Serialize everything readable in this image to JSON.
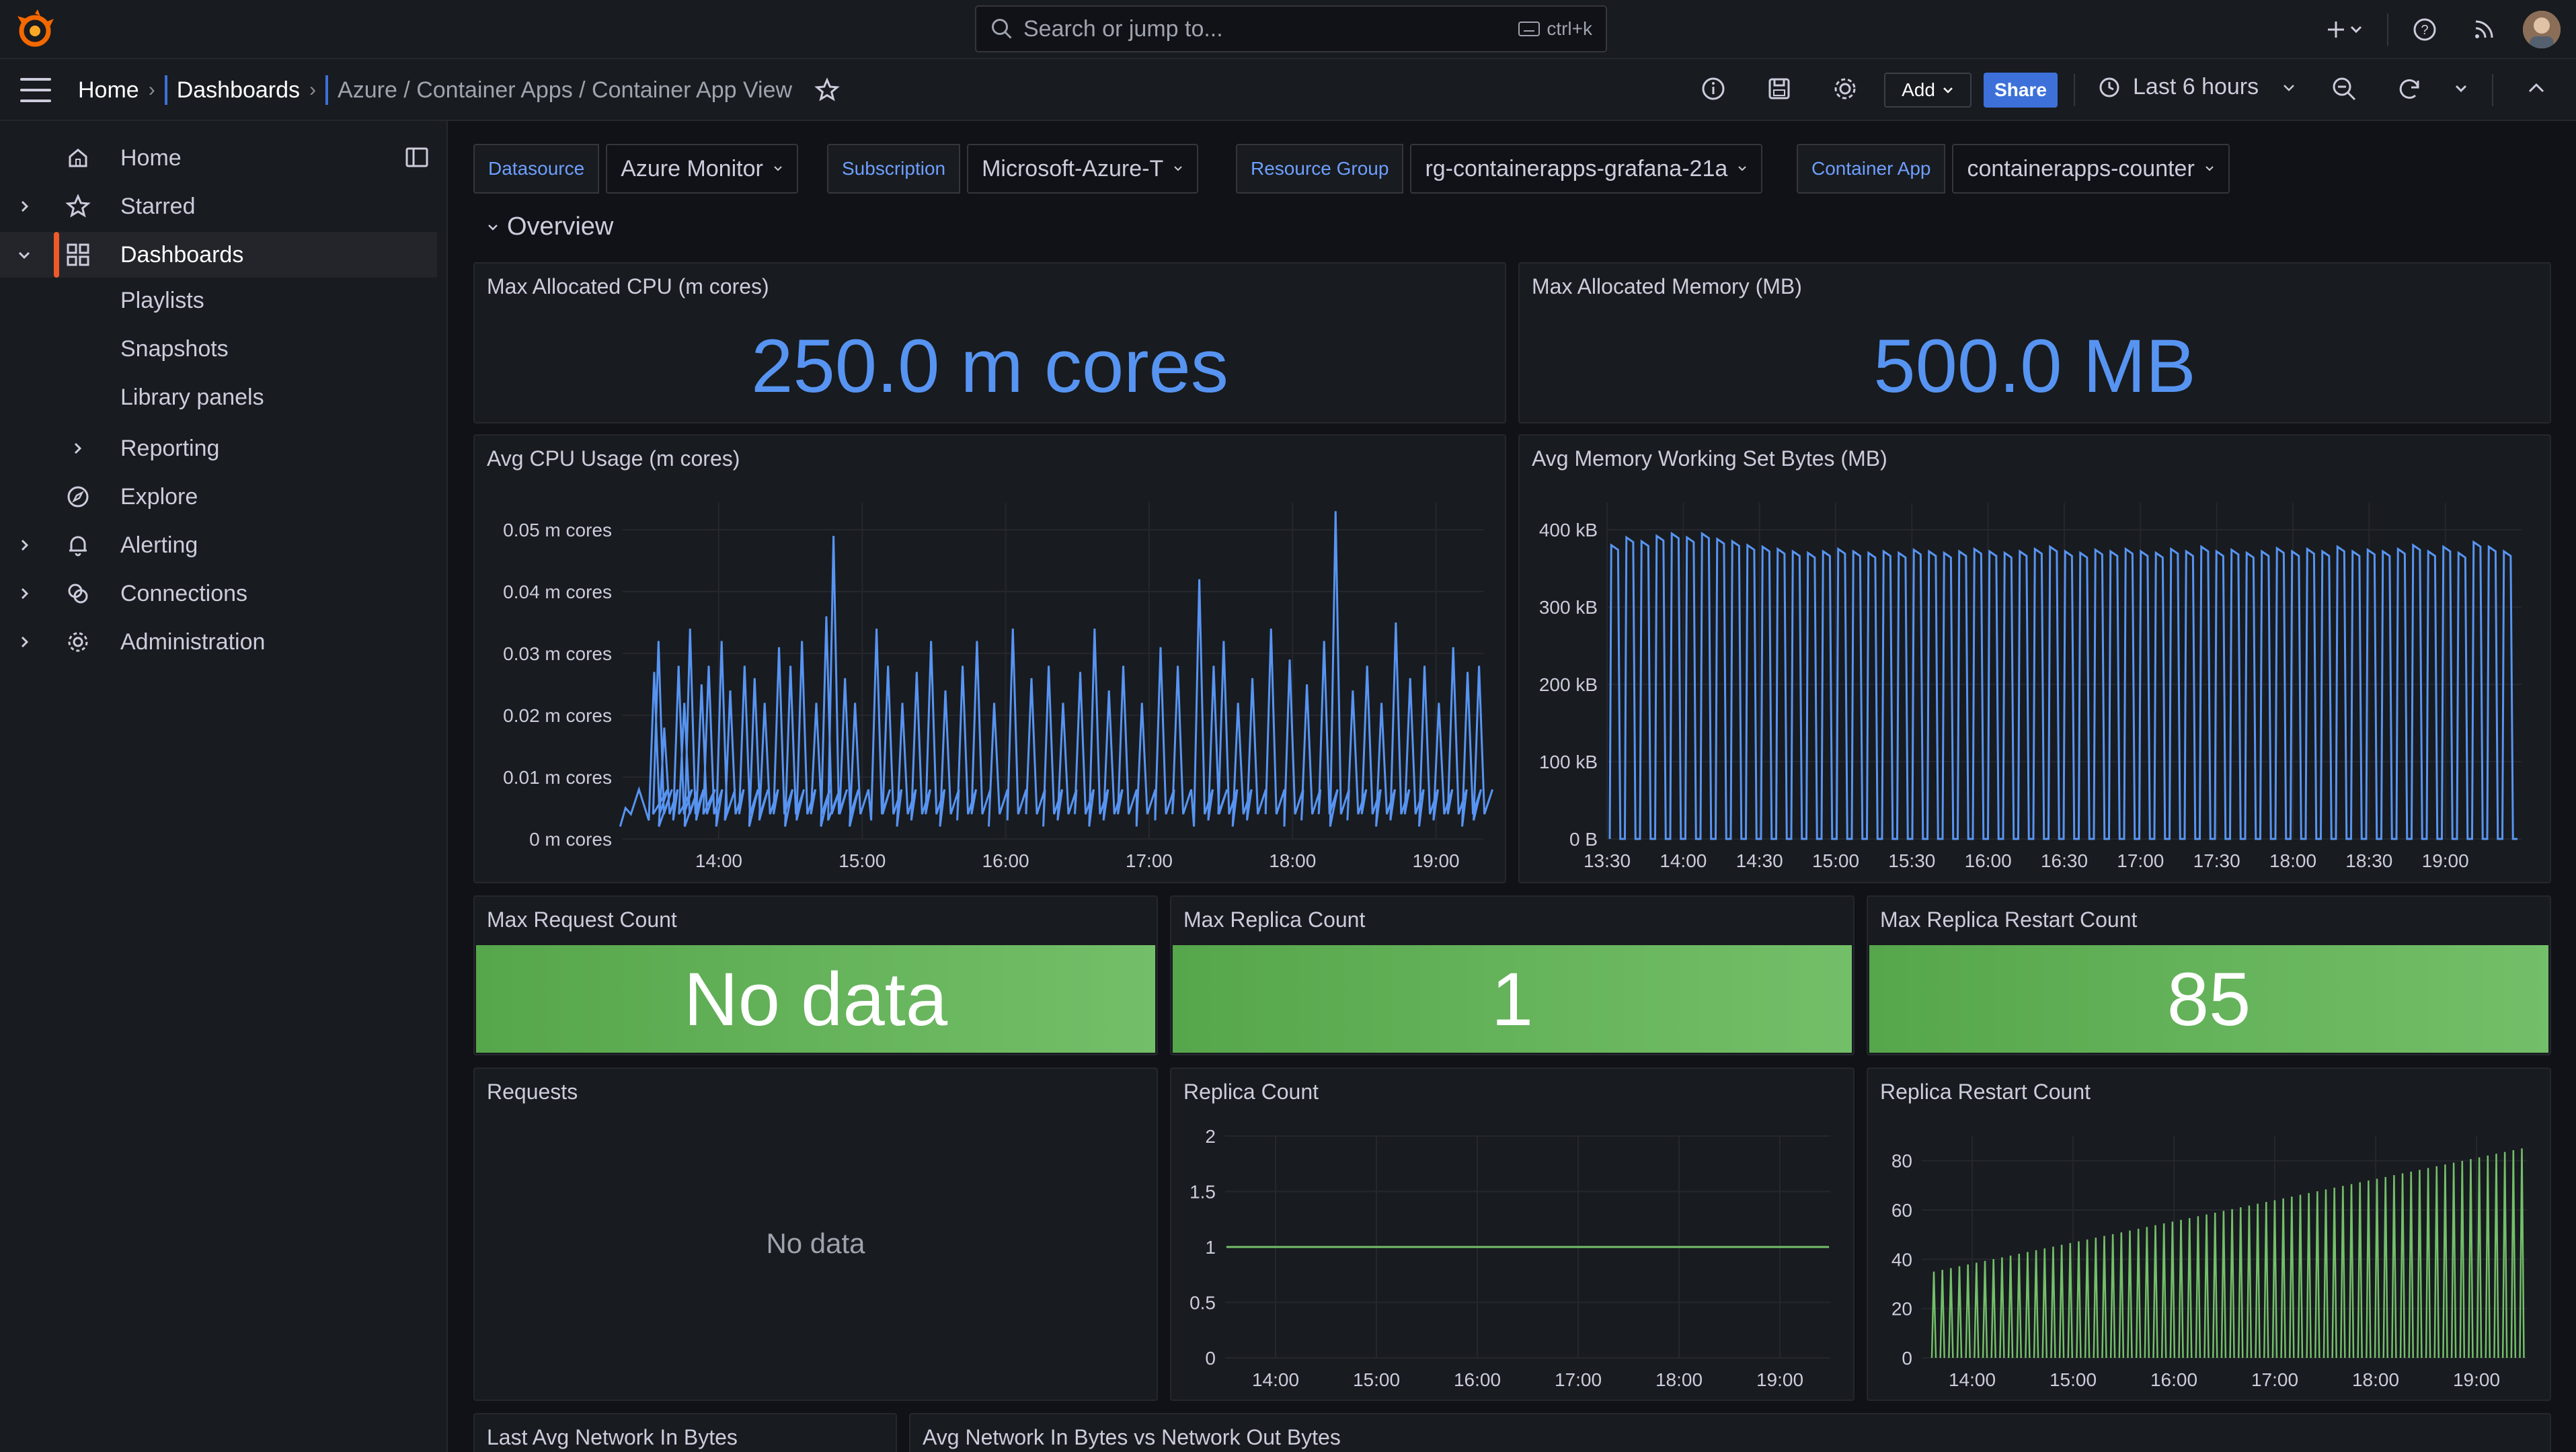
{
  "topbar": {
    "search_placeholder": "Search or jump to...",
    "search_shortcut": "ctrl+k"
  },
  "breadcrumb": {
    "home": "Home",
    "dashboards": "Dashboards",
    "path": "Azure / Container Apps / Container App View"
  },
  "toolbar": {
    "add_label": "Add",
    "share_label": "Share",
    "time_range": "Last 6 hours"
  },
  "sidebar": {
    "items": [
      {
        "label": "Home",
        "icon": "home-icon"
      },
      {
        "label": "Starred",
        "icon": "star-icon"
      },
      {
        "label": "Dashboards",
        "icon": "apps-icon"
      },
      {
        "label": "Playlists"
      },
      {
        "label": "Snapshots"
      },
      {
        "label": "Library panels"
      },
      {
        "label": "Reporting"
      },
      {
        "label": "Explore",
        "icon": "compass-icon"
      },
      {
        "label": "Alerting",
        "icon": "bell-icon"
      },
      {
        "label": "Connections",
        "icon": "connections-icon"
      },
      {
        "label": "Administration",
        "icon": "cog-icon"
      }
    ]
  },
  "variables": [
    {
      "label": "Datasource",
      "value": "Azure Monitor"
    },
    {
      "label": "Subscription",
      "value": "Microsoft-Azure-T"
    },
    {
      "label": "Resource Group",
      "value": "rg-containerapps-grafana-21a"
    },
    {
      "label": "Container App",
      "value": "containerapps-counter"
    }
  ],
  "row_title": "Overview",
  "panels": {
    "max_cpu": {
      "title": "Max Allocated CPU (m cores)",
      "value": "250.0 m cores"
    },
    "max_mem": {
      "title": "Max Allocated Memory (MB)",
      "value": "500.0 MB"
    },
    "avg_cpu": {
      "title": "Avg CPU Usage (m cores)"
    },
    "avg_mem": {
      "title": "Avg Memory Working Set Bytes (MB)"
    },
    "max_req": {
      "title": "Max Request Count",
      "value": "No data"
    },
    "max_replica": {
      "title": "Max Replica Count",
      "value": "1"
    },
    "max_restart": {
      "title": "Max Replica Restart Count",
      "value": "85"
    },
    "requests": {
      "title": "Requests",
      "empty": "No data"
    },
    "replica": {
      "title": "Replica Count"
    },
    "restart": {
      "title": "Replica Restart Count"
    },
    "net_in_last": {
      "title": "Last Avg Network In Bytes"
    },
    "net_in_out": {
      "title": "Avg Network In Bytes vs Network Out Bytes"
    }
  },
  "colors": {
    "accent_blue": "#5794f2",
    "stat_green": "#73bf69",
    "background": "#111217",
    "panel": "#181b1f"
  },
  "chart_data": [
    {
      "type": "line",
      "panel": "Avg CPU Usage (m cores)",
      "x_ticks": [
        "14:00",
        "15:00",
        "16:00",
        "17:00",
        "18:00",
        "19:00"
      ],
      "y_ticks": [
        "0 m cores",
        "0.01 m cores",
        "0.02 m cores",
        "0.03 m cores",
        "0.04 m cores",
        "0.05 m cores"
      ],
      "ylim": [
        0,
        0.05
      ],
      "x_range": [
        "13:30",
        "19:30"
      ],
      "series": [
        {
          "color": "#5794f2",
          "x_hours": [
            13.35,
            13.55,
            13.58,
            13.62,
            13.72,
            13.76,
            13.8,
            13.88,
            13.93,
            14.02,
            14.08,
            14.18,
            14.25,
            14.32,
            14.42,
            14.5,
            14.58,
            14.68,
            14.75,
            14.8,
            14.88,
            14.95,
            15.1,
            15.18,
            15.28,
            15.38,
            15.48,
            15.58,
            15.7,
            15.8,
            15.92,
            16.05,
            16.18,
            16.3,
            16.4,
            16.52,
            16.62,
            16.72,
            16.82,
            16.95,
            17.08,
            17.2,
            17.35,
            17.45,
            17.52,
            17.62,
            17.72,
            17.85,
            17.98,
            18.1,
            18.22,
            18.3,
            18.42,
            18.52,
            18.62,
            18.72,
            18.82,
            18.92,
            19.02,
            19.12,
            19.22,
            19.3
          ],
          "values": [
            0.005,
            0.027,
            0.032,
            0.018,
            0.028,
            0.022,
            0.034,
            0.025,
            0.028,
            0.032,
            0.024,
            0.028,
            0.026,
            0.022,
            0.031,
            0.028,
            0.032,
            0.022,
            0.036,
            0.049,
            0.026,
            0.022,
            0.034,
            0.028,
            0.022,
            0.027,
            0.032,
            0.024,
            0.028,
            0.032,
            0.022,
            0.034,
            0.026,
            0.028,
            0.022,
            0.027,
            0.034,
            0.024,
            0.028,
            0.022,
            0.031,
            0.028,
            0.042,
            0.028,
            0.032,
            0.022,
            0.026,
            0.034,
            0.029,
            0.025,
            0.032,
            0.053,
            0.024,
            0.028,
            0.022,
            0.035,
            0.026,
            0.028,
            0.022,
            0.031,
            0.027,
            0.028
          ]
        }
      ]
    },
    {
      "type": "line",
      "panel": "Avg Memory Working Set Bytes (MB)",
      "x_ticks": [
        "13:30",
        "14:00",
        "14:30",
        "15:00",
        "15:30",
        "16:00",
        "16:30",
        "17:00",
        "17:30",
        "18:00",
        "18:30",
        "19:00"
      ],
      "y_ticks": [
        "0 B",
        "100 kB",
        "200 kB",
        "300 kB",
        "400 kB"
      ],
      "ylim": [
        0,
        400
      ],
      "y_unit": "kB",
      "series": [
        {
          "color": "#5794f2",
          "pattern": "square wave: ~60 cycles between ~0 kB and ~370-395 kB across 13:30-19:30",
          "peak_values": [
            380,
            390,
            385,
            392,
            395,
            390,
            395,
            388,
            385,
            380,
            378,
            375,
            372,
            370,
            372,
            375,
            372,
            370,
            372,
            370,
            374,
            372,
            370,
            372,
            375,
            372,
            370,
            372,
            375,
            378,
            372,
            370,
            374,
            372,
            375,
            372,
            370,
            375,
            372,
            378,
            372,
            374,
            370,
            372,
            376,
            372,
            375,
            372,
            378,
            372,
            374,
            372,
            375,
            380,
            372,
            378,
            370,
            384,
            378,
            372
          ]
        }
      ]
    },
    {
      "type": "line",
      "panel": "Replica Count",
      "x_ticks": [
        "14:00",
        "15:00",
        "16:00",
        "17:00",
        "18:00",
        "19:00"
      ],
      "y_ticks": [
        "0",
        "0.5",
        "1",
        "1.5",
        "2"
      ],
      "ylim": [
        0,
        2
      ],
      "series": [
        {
          "color": "#73bf69",
          "constant_value": 1
        }
      ]
    },
    {
      "type": "line",
      "panel": "Replica Restart Count",
      "x_ticks": [
        "14:00",
        "15:00",
        "16:00",
        "17:00",
        "18:00",
        "19:00"
      ],
      "y_ticks": [
        "0",
        "20",
        "40",
        "60",
        "80"
      ],
      "ylim": [
        0,
        90
      ],
      "series": [
        {
          "color": "#73bf69",
          "pattern": "spikes from 0 rising linearly from ~35 at 13:40 to ~85 at 19:30, about 70 spikes"
        }
      ]
    }
  ]
}
